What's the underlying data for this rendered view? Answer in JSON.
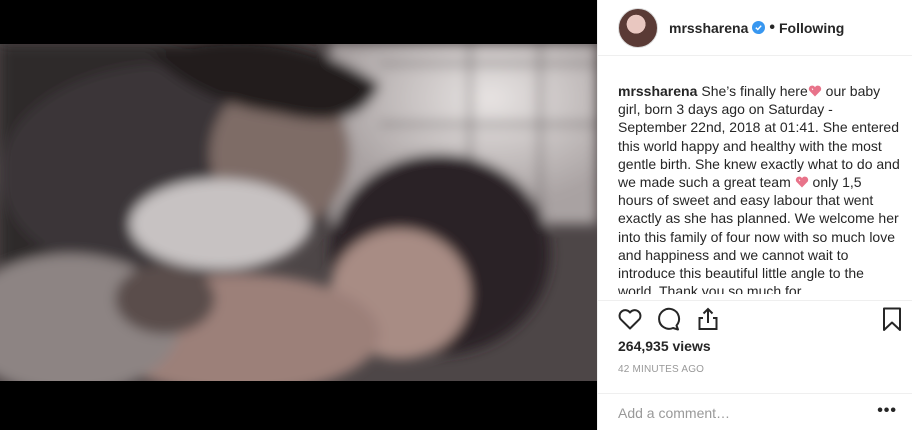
{
  "post": {
    "username": "mrssharena",
    "separator": "•",
    "follow_status": "Following",
    "caption_user": "mrssharena",
    "caption_text_1": "She’s finally here",
    "caption_text_2": " our baby girl, born 3 days ago on Saturday - September 22nd, 2018 at 01:41. She entered this world happy and healthy with the most gentle birth. She knew exactly what to do and we made such a great team ",
    "caption_text_3": " only 1,5 hours of sweet and easy labour that went exactly as she has planned. We welcome her into this family of four now with so much love and happiness and we cannot wait to introduce this beautiful little angle to the world. Thank you so much for",
    "views": "264,935 views",
    "timestamp": "42 MINUTES AGO"
  },
  "comment": {
    "placeholder": "Add a comment…",
    "more_label": "•••"
  },
  "icons": {
    "verified": "verified-badge-icon",
    "like": "heart-icon",
    "comment": "speech-bubble-icon",
    "share": "share-icon",
    "save": "bookmark-icon",
    "emoji_heart": "sparkling-heart-emoji"
  },
  "colors": {
    "verified_blue": "#3897f0",
    "heart_emoji": "#e8738a",
    "meta_gray": "#999999"
  }
}
